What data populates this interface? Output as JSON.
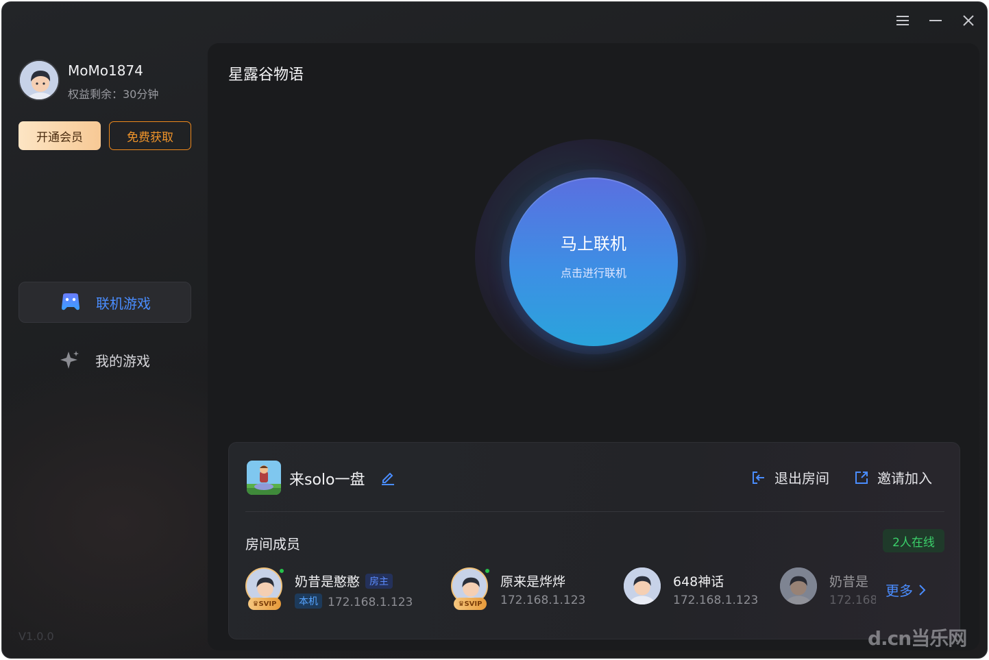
{
  "window_controls": {
    "menu_icon": "menu-icon",
    "minimize_icon": "minimize-icon",
    "close_icon": "close-icon"
  },
  "sidebar": {
    "username": "MoMo1874",
    "quota": "权益剩余：30分钟",
    "vip_button": "开通会员",
    "free_button": "免费获取",
    "nav": [
      {
        "label": "联机游戏",
        "icon": "gamepad-icon",
        "active": true
      },
      {
        "label": "我的游戏",
        "icon": "sparkle-icon",
        "active": false
      }
    ],
    "version": "V1.0.0"
  },
  "main": {
    "game_title": "星露谷物语",
    "connect": {
      "title": "马上联机",
      "subtitle": "点击进行联机"
    },
    "room": {
      "name": "来solo一盘",
      "exit_label": "退出房间",
      "invite_label": "邀请加入",
      "members_title": "房间成员",
      "online_count": "2人在线",
      "members": [
        {
          "name": "奶昔是憨憨",
          "tag": "房主",
          "local_tag": "本机",
          "ip": "172.168.1.123",
          "svip": "SVIP",
          "online": true
        },
        {
          "name": "原来是烨烨",
          "ip": "172.168.1.123",
          "svip": "SVIP",
          "online": true
        },
        {
          "name": "648神话",
          "ip": "172.168.1.123",
          "online": false
        },
        {
          "name": "奶昔是",
          "ip": "172.168",
          "online": false
        }
      ],
      "more_label": "更多"
    }
  },
  "watermark": "d.cn当乐网",
  "colors": {
    "accent": "#4a8dff",
    "orange": "#f2952a",
    "online_green": "#3bd06a"
  }
}
